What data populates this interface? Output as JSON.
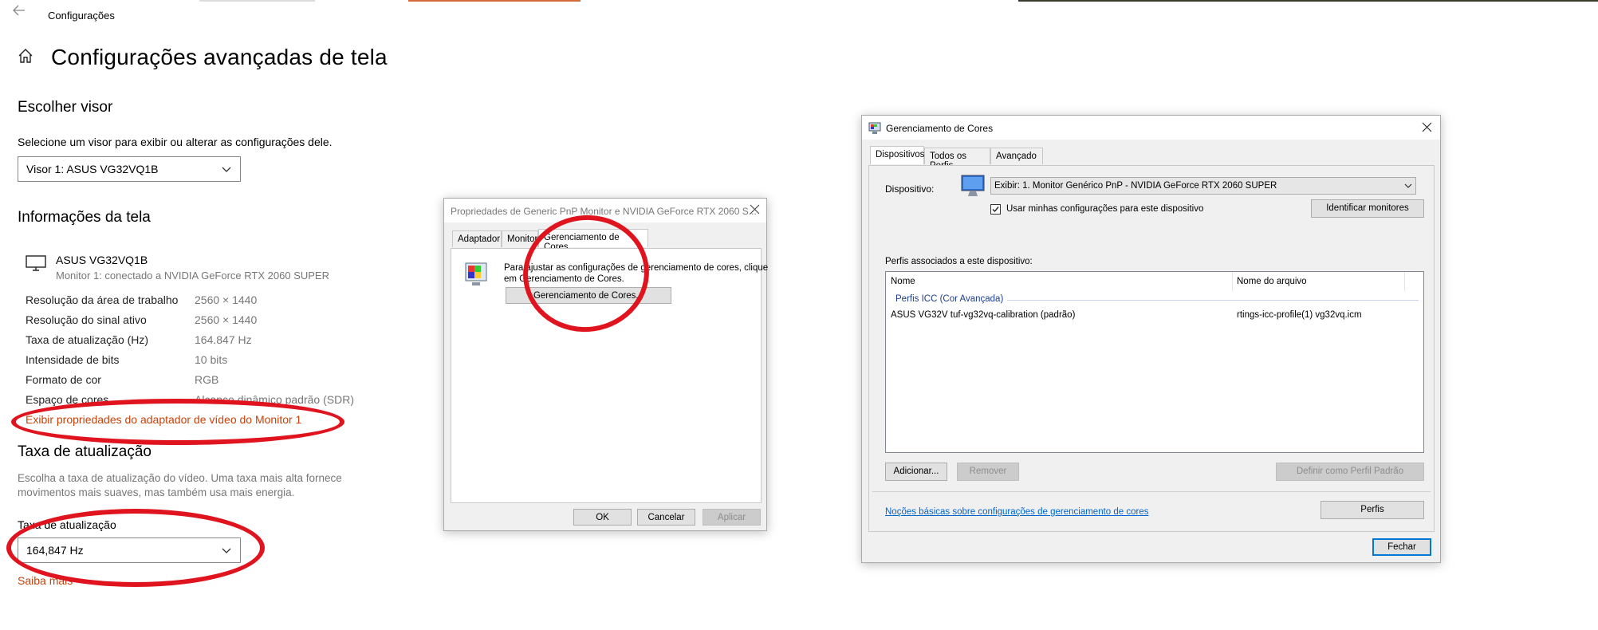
{
  "settings": {
    "window_title": "Configurações",
    "page_title": "Configurações avançadas de tela",
    "choose_display": {
      "heading": "Escolher visor",
      "description": "Selecione um visor para exibir ou alterar as configurações dele.",
      "selected": "Visor 1: ASUS VG32VQ1B"
    },
    "display_info": {
      "heading": "Informações da tela",
      "monitor_name": "ASUS VG32VQ1B",
      "monitor_sub": "Monitor 1: conectado a NVIDIA GeForce RTX 2060 SUPER",
      "rows": [
        {
          "label": "Resolução da área de trabalho",
          "value": "2560 × 1440"
        },
        {
          "label": "Resolução do sinal ativo",
          "value": "2560 × 1440"
        },
        {
          "label": "Taxa de atualização (Hz)",
          "value": "164.847 Hz"
        },
        {
          "label": "Intensidade de bits",
          "value": "10 bits"
        },
        {
          "label": "Formato de cor",
          "value": "RGB"
        },
        {
          "label": "Espaço de cores",
          "value": "Alcance dinâmico padrão (SDR)"
        }
      ],
      "adapter_link": "Exibir propriedades do adaptador de vídeo do Monitor 1"
    },
    "refresh": {
      "heading": "Taxa de atualização",
      "description_1": "Escolha a taxa de atualização do vídeo. Uma taxa mais alta fornece",
      "description_2": "movimentos mais suaves, mas também usa mais energia.",
      "label": "Taxa de atualização",
      "selected": "164,847 Hz",
      "learn_more": "Saiba mais"
    }
  },
  "props_dialog": {
    "title": "Propriedades de Generic PnP Monitor e NVIDIA GeForce RTX 2060 S...",
    "tabs": [
      "Adaptador",
      "Monitor",
      "Gerenciamento de Cores"
    ],
    "text_1": "Para ajustar as configurações de gerenciamento de cores, clique",
    "text_2": "em Gerenciamento de Cores.",
    "color_mgmt_button": "Gerenciamento de Cores...",
    "ok": "OK",
    "cancel": "Cancelar",
    "apply": "Aplicar"
  },
  "color_dialog": {
    "title": "Gerenciamento de Cores",
    "tabs": [
      "Dispositivos",
      "Todos os Perfis",
      "Avançado"
    ],
    "device_label": "Dispositivo:",
    "device_selected": "Exibir: 1. Monitor Genérico PnP - NVIDIA GeForce RTX 2060 SUPER",
    "use_my_settings": "Usar minhas configurações para este dispositivo",
    "identify_button": "Identificar monitores",
    "profiles_label": "Perfis associados a este dispositivo:",
    "columns": [
      "Nome",
      "Nome do arquivo"
    ],
    "group": "Perfis ICC (Cor Avançada)",
    "profiles": [
      {
        "name": "ASUS VG32V tuf-vg32vq-calibration (padrão)",
        "file": "rtings-icc-profile(1) vg32vq.icm"
      }
    ],
    "add_button": "Adicionar...",
    "remove_button": "Remover",
    "set_default_button": "Definir como Perfil Padrão",
    "profiles_button": "Perfis",
    "basics_link": "Noções básicas sobre configurações de gerenciamento de cores",
    "close_button": "Fechar"
  },
  "colors": {
    "accent_link": "#c84108",
    "annotation_red": "#e0141e",
    "win_blue": "#0066cc",
    "focus_blue": "#0078d7"
  }
}
